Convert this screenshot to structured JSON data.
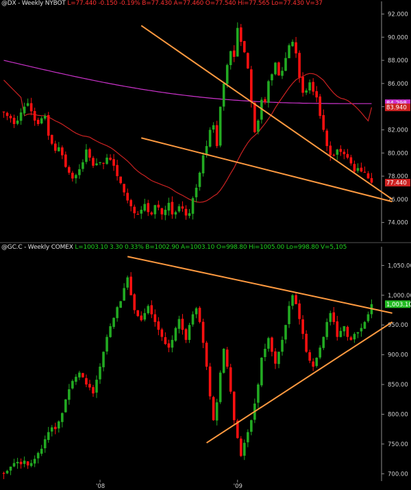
{
  "top_panel": {
    "header": {
      "symbol": "@DX - Weekly  NYBOT",
      "last": "L=77.440",
      "change": "-0.150",
      "change_pct": "-0.19%",
      "bid": "B=77.430",
      "ask": "A=77.460",
      "open": "O=77.540",
      "high": "Hi=77.565",
      "low": "Lo=77.430",
      "volume": "V=37"
    },
    "axis_labels": [
      "92.000",
      "90.000",
      "88.000",
      "86.000",
      "84.000",
      "82.000",
      "80.000",
      "78.000",
      "76.000",
      "74.000"
    ],
    "price_tags": [
      {
        "text": "84.298",
        "color": "#cc33cc"
      },
      {
        "text": "83.940",
        "color": "#cc2222"
      },
      {
        "text": "77.440",
        "color": "#cc2222"
      }
    ]
  },
  "bottom_panel": {
    "header": {
      "symbol": "@GC.C - Weekly  COMEX",
      "last": "L=1003.10",
      "change": "3.30",
      "change_pct": "0.33%",
      "bid": "B=1002.90",
      "ask": "A=1003.10",
      "open": "O=998.80",
      "high": "Hi=1005.00",
      "low": "Lo=998.80",
      "volume": "V=5,105"
    },
    "axis_labels": [
      "1,050.00",
      "1,000.00",
      "950.00",
      "900.00",
      "850.00",
      "800.00",
      "750.00",
      "700.00"
    ],
    "price_tags": [
      {
        "text": "1,003.10",
        "color": "#22bb22"
      }
    ]
  },
  "x_axis_labels": [
    "'08",
    "'09"
  ],
  "colors": {
    "background": "#000000",
    "up_candle": "#22aa22",
    "down_candle": "#ff1010",
    "trendline": "#ff9a40",
    "ma_short": "#cc2222",
    "ma_long": "#cc33cc",
    "axis_text": "#d0d0d0",
    "axis_line": "#909090"
  },
  "chart_data": [
    {
      "type": "candlestick",
      "title": "@DX - Weekly  NYBOT",
      "xlabel": "",
      "ylabel": "",
      "ylim": [
        72.5,
        92.5
      ],
      "grid": false,
      "close_series": [
        83.5,
        83.2,
        83.0,
        82.5,
        82.8,
        83.5,
        84.0,
        84.3,
        83.6,
        82.8,
        82.5,
        83.0,
        83.2,
        81.5,
        80.8,
        80.2,
        80.5,
        79.8,
        78.8,
        78.3,
        77.8,
        78.1,
        78.6,
        79.2,
        80.3,
        79.6,
        78.9,
        79.1,
        79.2,
        79.1,
        79.6,
        79.4,
        78.9,
        78.0,
        77.4,
        76.6,
        75.9,
        75.4,
        74.8,
        74.7,
        75.1,
        75.6,
        74.9,
        74.7,
        75.5,
        75.3,
        74.7,
        75.1,
        75.7,
        74.7,
        74.9,
        75.4,
        75.2,
        74.6,
        74.8,
        76.1,
        77.0,
        78.3,
        79.8,
        80.6,
        82.0,
        82.4,
        80.6,
        84.0,
        86.0,
        87.6,
        88.8,
        88.3,
        90.8,
        89.6,
        88.7,
        87.3,
        84.4,
        81.8,
        82.8,
        84.6,
        84.4,
        86.2,
        86.8,
        87.8,
        86.7,
        87.1,
        88.2,
        89.3,
        89.6,
        88.6,
        86.5,
        85.2,
        85.4,
        86.1,
        85.3,
        84.8,
        83.2,
        82.0,
        80.6,
        79.8,
        79.8,
        80.3,
        80.1,
        79.9,
        79.6,
        79.1,
        78.4,
        78.7,
        78.4,
        78.3,
        77.8,
        77.44
      ],
      "trendlines": [
        {
          "from": [
            40,
            91.0
          ],
          "to": [
            113,
            76.0
          ]
        },
        {
          "from": [
            40,
            81.3
          ],
          "to": [
            113,
            75.8
          ]
        }
      ],
      "moving_averages": [
        {
          "last": 84.298,
          "color": "#cc33cc"
        },
        {
          "last": 83.94,
          "color": "#cc2222"
        }
      ]
    },
    {
      "type": "candlestick",
      "title": "@GC.C - Weekly  COMEX",
      "xlabel": "",
      "ylabel": "",
      "ylim": [
        690,
        1070
      ],
      "grid": false,
      "close_series": [
        700,
        705,
        712,
        718,
        720,
        716,
        722,
        714,
        718,
        725,
        735,
        742,
        758,
        770,
        778,
        775,
        788,
        802,
        825,
        842,
        856,
        863,
        870,
        862,
        850,
        845,
        835,
        858,
        880,
        905,
        930,
        948,
        962,
        980,
        990,
        1012,
        1030,
        1000,
        975,
        965,
        958,
        970,
        982,
        968,
        955,
        942,
        930,
        918,
        912,
        925,
        945,
        960,
        942,
        925,
        950,
        968,
        978,
        955,
        920,
        880,
        830,
        790,
        820,
        870,
        910,
        880,
        838,
        790,
        760,
        730,
        752,
        770,
        790,
        818,
        850,
        895,
        910,
        928,
        905,
        885,
        905,
        925,
        950,
        982,
        1000,
        985,
        960,
        935,
        905,
        890,
        880,
        895,
        912,
        930,
        955,
        970,
        955,
        930,
        940,
        948,
        930,
        925,
        935,
        938,
        945,
        955,
        968,
        985,
        998,
        1003.1
      ],
      "trendlines": [
        {
          "from": [
            36,
            1065
          ],
          "to": [
            113,
            970
          ]
        },
        {
          "from": [
            59,
            752
          ],
          "to": [
            113,
            955
          ]
        }
      ]
    }
  ]
}
